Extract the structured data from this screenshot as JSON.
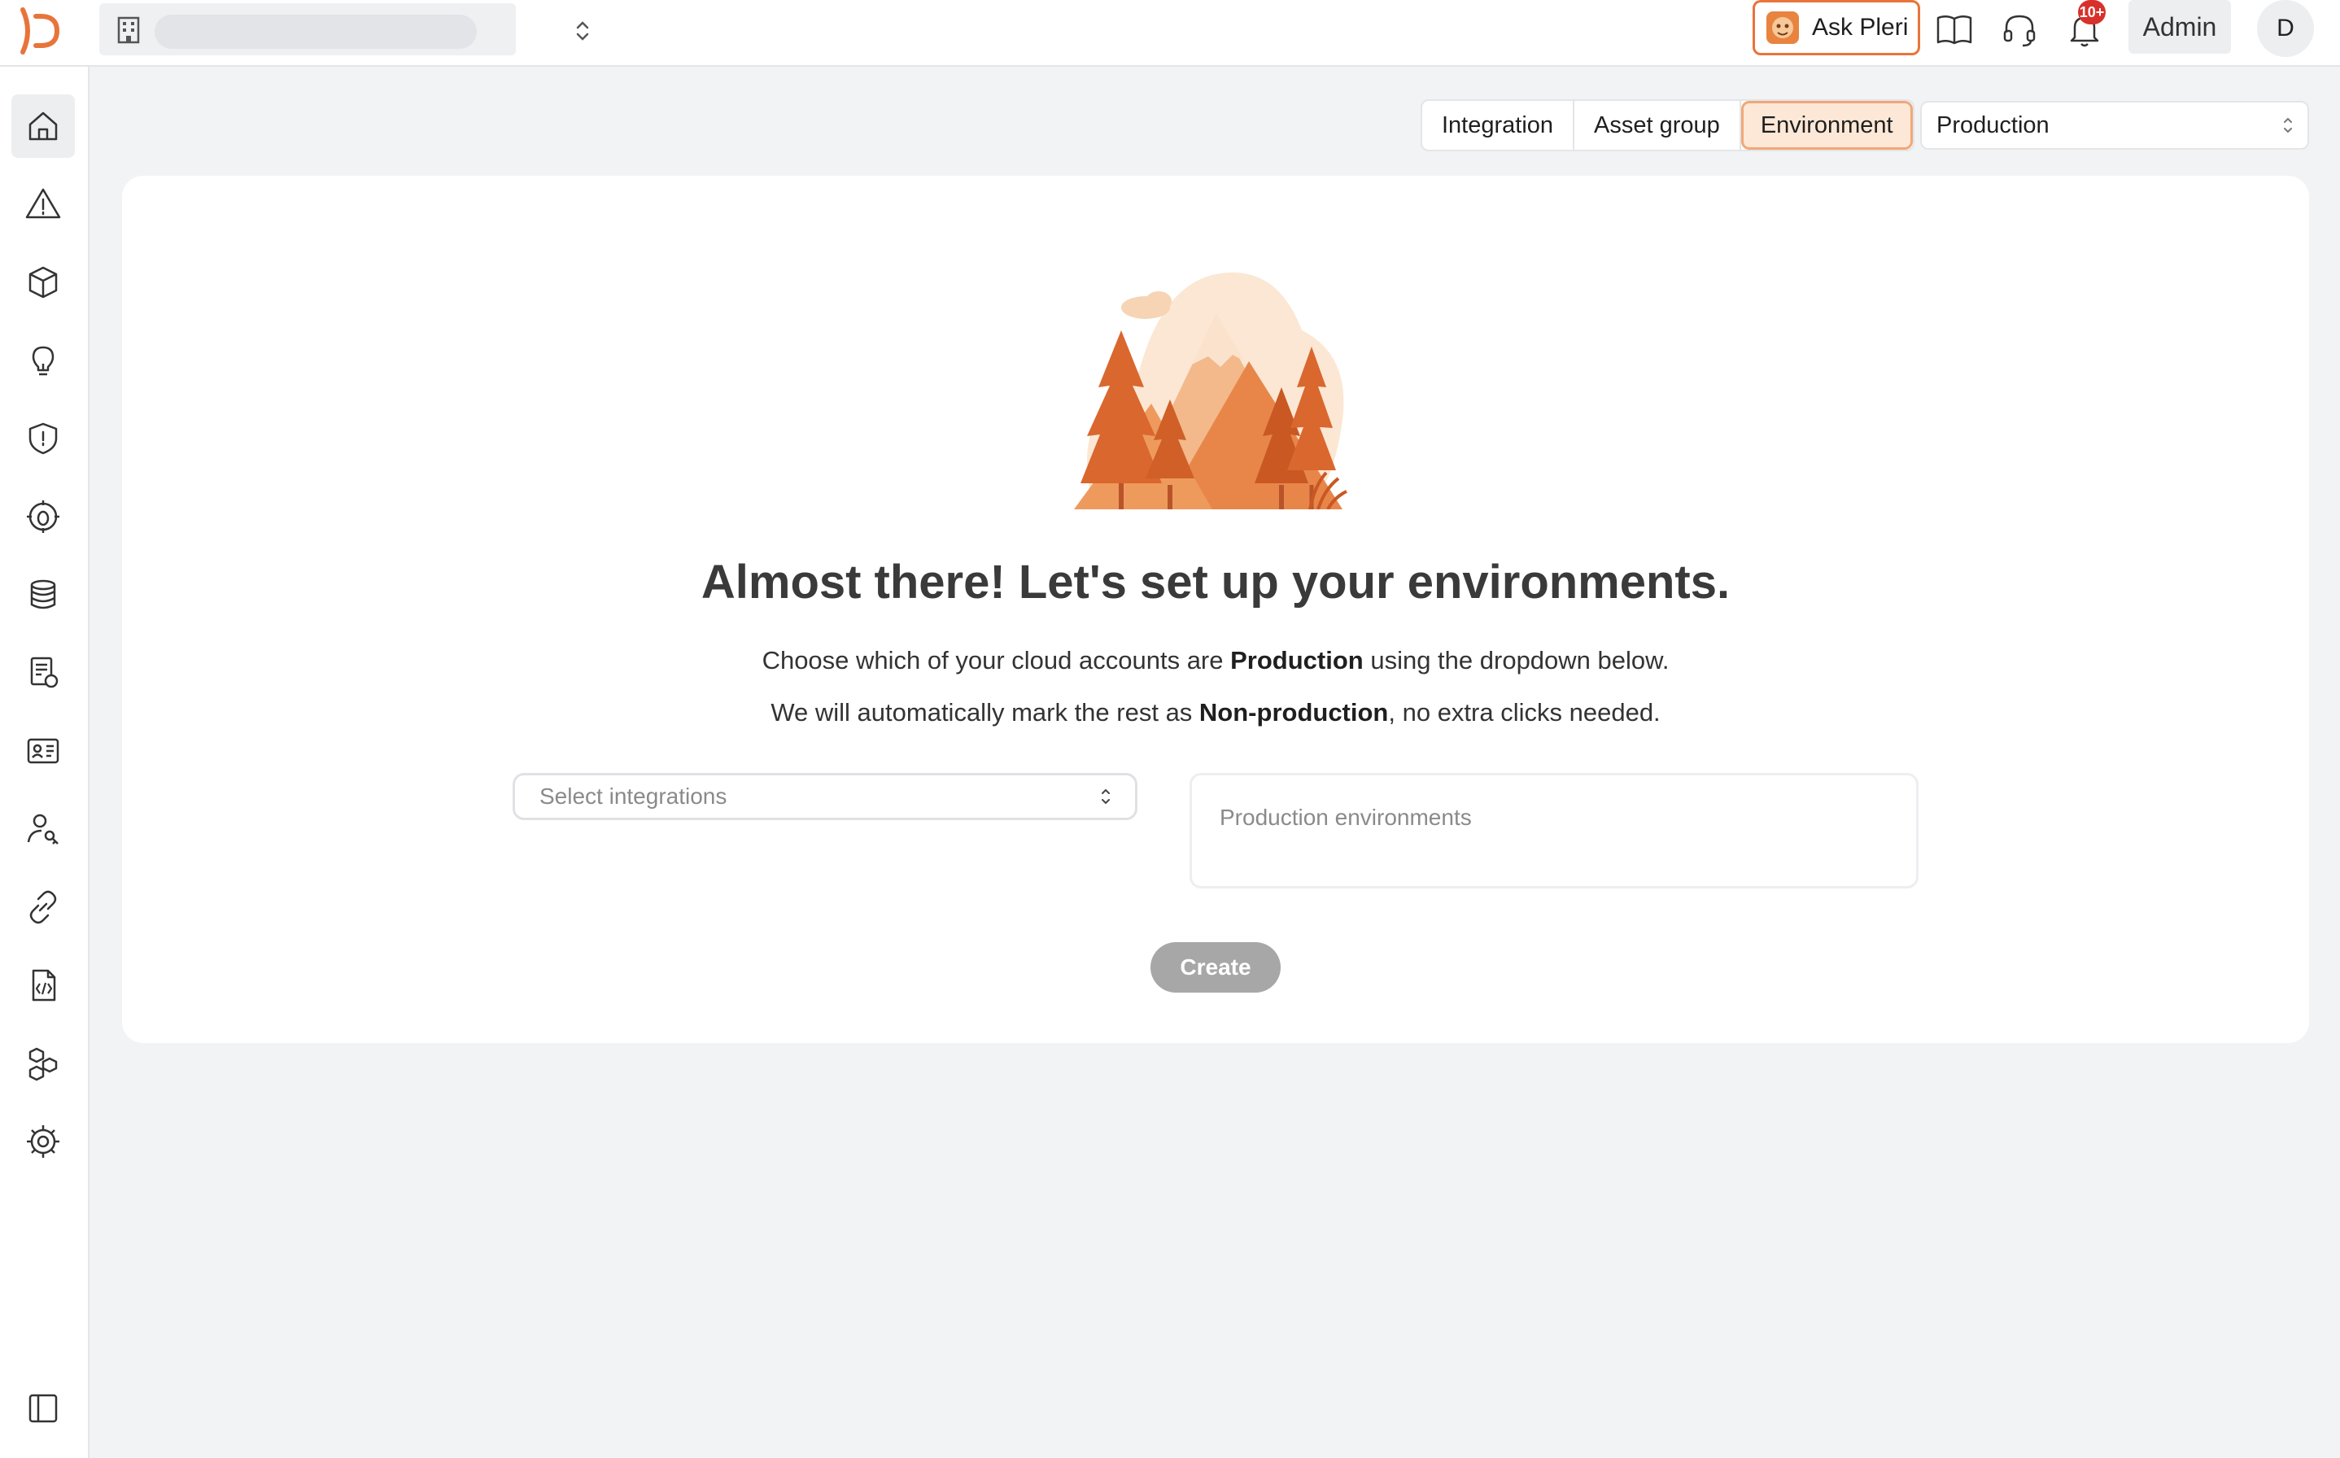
{
  "topbar": {
    "ask_pleri_label": "Ask Pleri",
    "notifications_badge": "10+",
    "admin_label": "Admin",
    "avatar_initial": "D"
  },
  "sidebar": {
    "items": [
      {
        "name": "home",
        "icon": "home-icon",
        "active": true
      },
      {
        "name": "alerts",
        "icon": "warning-triangle-icon"
      },
      {
        "name": "assets",
        "icon": "cube-icon"
      },
      {
        "name": "insights",
        "icon": "lightbulb-icon"
      },
      {
        "name": "security",
        "icon": "shield-icon"
      },
      {
        "name": "vulnerabilities",
        "icon": "bug-target-icon"
      },
      {
        "name": "data",
        "icon": "database-icon"
      },
      {
        "name": "compliance",
        "icon": "document-badge-icon"
      },
      {
        "name": "identities",
        "icon": "id-card-icon"
      },
      {
        "name": "access",
        "icon": "user-key-icon"
      },
      {
        "name": "integrations",
        "icon": "link-icon"
      },
      {
        "name": "code",
        "icon": "code-file-icon"
      },
      {
        "name": "workflows",
        "icon": "hexagons-icon"
      },
      {
        "name": "settings",
        "icon": "gear-icon"
      }
    ],
    "collapse_icon": "sidebar-toggle-icon"
  },
  "filters": {
    "options": [
      "Integration",
      "Asset group",
      "Environment"
    ],
    "selected": "Environment",
    "environment_value": "Production"
  },
  "main": {
    "heading": "Almost there! Let's set up your environments.",
    "line1_pre": "Choose which of your cloud accounts are ",
    "line1_bold": "Production",
    "line1_post": " using the dropdown below.",
    "line2_pre": "We will automatically mark the rest as ",
    "line2_bold": "Non-production",
    "line2_post": ", no extra clicks needed.",
    "integrations_placeholder": "Select integrations",
    "production_placeholder": "Production environments",
    "create_label": "Create"
  },
  "colors": {
    "accent": "#e8743b",
    "accent_light": "#fde8d7",
    "badge": "#d8312b",
    "disabled_button": "#a7a7a7"
  }
}
